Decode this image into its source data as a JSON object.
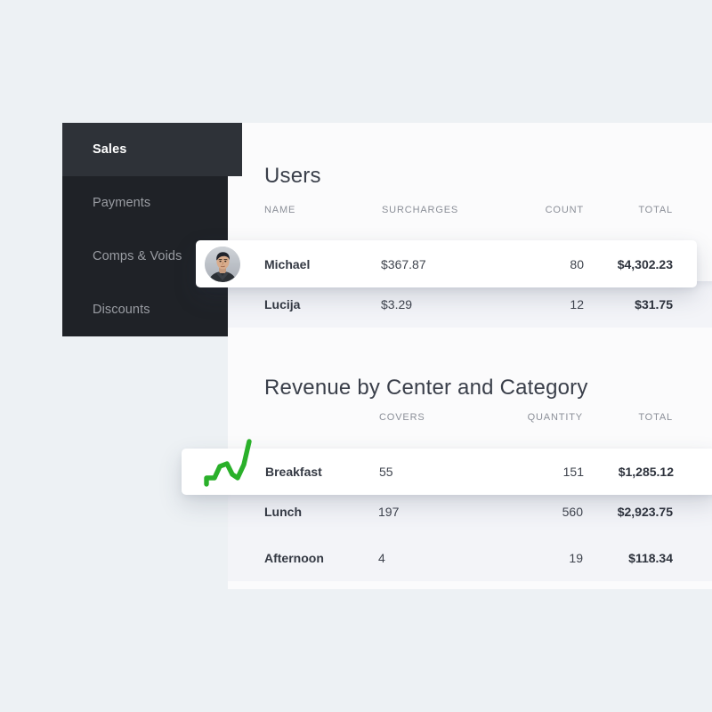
{
  "colors": {
    "page_background": "#edf1f4",
    "sidebar_background": "#1f2227",
    "sidebar_active_background": "#2e3238",
    "panel_background": "#fbfbfc",
    "row_alt_background": "#f3f4f8",
    "accent_green": "#2ab02a",
    "text_primary": "#3f444e",
    "text_muted": "#8b8f98"
  },
  "sidebar": {
    "items": [
      {
        "label": "Sales",
        "active": true
      },
      {
        "label": "Payments",
        "active": false
      },
      {
        "label": "Comps & Voids",
        "active": false
      },
      {
        "label": "Discounts",
        "active": false
      }
    ]
  },
  "users_section": {
    "title": "Users",
    "columns": [
      "NAME",
      "SURCHARGES",
      "COUNT",
      "TOTAL"
    ],
    "rows": [
      {
        "name": "Michael",
        "surcharges": "$367.87",
        "count": "80",
        "total": "$4,302.23",
        "highlighted": true,
        "avatar": "user-photo-avatar"
      },
      {
        "name": "Lucija",
        "surcharges": "$3.29",
        "count": "12",
        "total": "$31.75",
        "highlighted": false
      }
    ]
  },
  "revenue_section": {
    "title": "Revenue by Center and Category",
    "columns": [
      "",
      "COVERS",
      "QUANTITY",
      "TOTAL"
    ],
    "rows": [
      {
        "name": "Breakfast",
        "covers": "55",
        "quantity": "151",
        "total": "$1,285.12",
        "highlighted": true,
        "icon": "line-chart-icon"
      },
      {
        "name": "Lunch",
        "covers": "197",
        "quantity": "560",
        "total": "$2,923.75",
        "highlighted": false
      },
      {
        "name": "Afternoon",
        "covers": "4",
        "quantity": "19",
        "total": "$118.34",
        "highlighted": false
      }
    ]
  }
}
